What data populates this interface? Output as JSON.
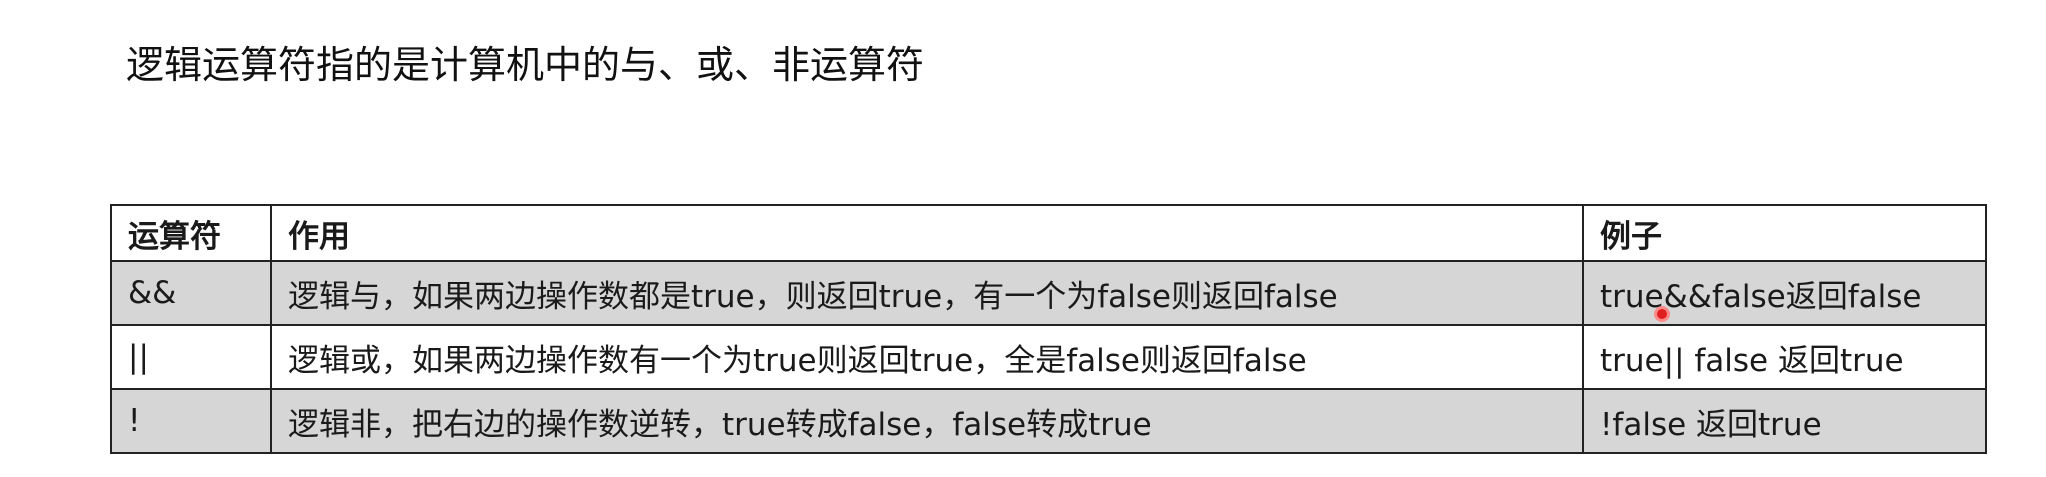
{
  "heading": "逻辑运算符指的是计算机中的与、或、非运算符",
  "table": {
    "headers": [
      "运算符",
      "作用",
      "例子"
    ],
    "rows": [
      {
        "operator": "&&",
        "description": "逻辑与，如果两边操作数都是true，则返回true，有一个为false则返回false",
        "example": "true&&false返回false"
      },
      {
        "operator": "||",
        "description": "逻辑或，如果两边操作数有一个为true则返回true，全是false则返回false",
        "example": "true|| false 返回true"
      },
      {
        "operator": "!",
        "description": "逻辑非，把右边的操作数逆转，true转成false，false转成true",
        "example": "!false 返回true"
      }
    ],
    "shaded_row_color": "#d6d6d6"
  },
  "cursor": {
    "color": "#e02020"
  }
}
